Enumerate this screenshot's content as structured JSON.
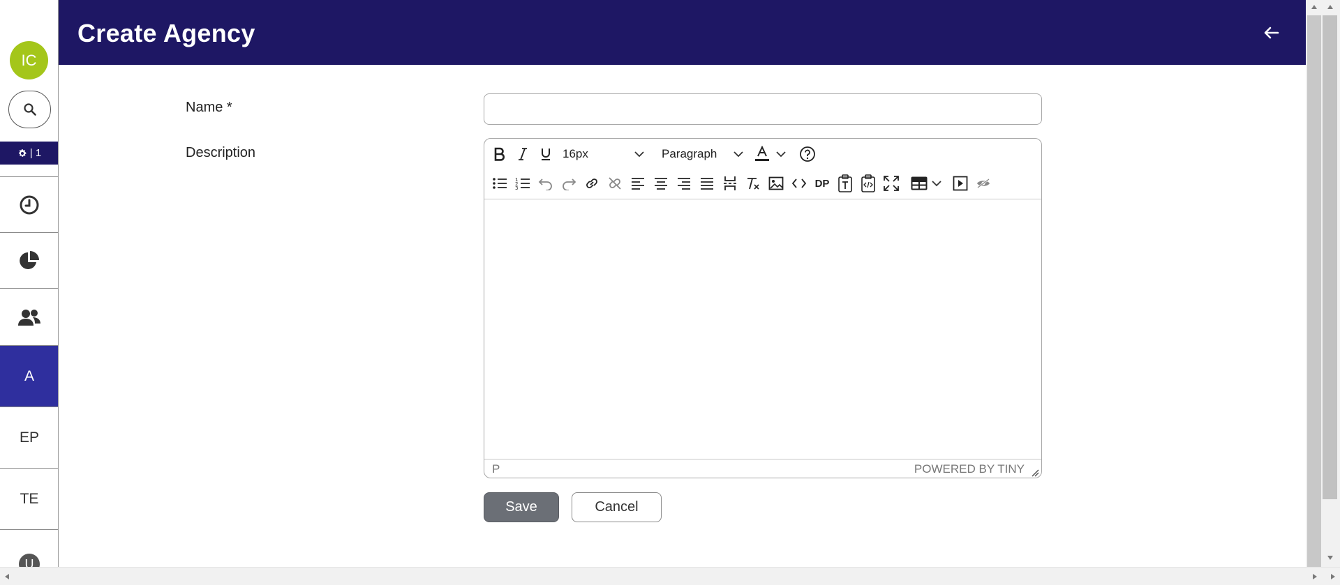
{
  "sidebar": {
    "avatar_initials": "IC",
    "settings_label": "| 1",
    "items": [
      {
        "name": "history",
        "icon": "clock-icon"
      },
      {
        "name": "reports",
        "icon": "pie-chart-icon"
      },
      {
        "name": "users",
        "icon": "users-icon"
      },
      {
        "name": "agencies",
        "label": "A",
        "active": true
      },
      {
        "name": "ep",
        "label": "EP"
      },
      {
        "name": "te",
        "label": "TE"
      },
      {
        "name": "more",
        "label": "U"
      }
    ]
  },
  "header": {
    "title": "Create Agency",
    "back_icon": "arrow-left-icon",
    "background": "#1e1764"
  },
  "form": {
    "name_label": "Name *",
    "name_value": "",
    "description_label": "Description"
  },
  "editor": {
    "font_size": "16px",
    "block_format": "Paragraph",
    "dp_label": "DP",
    "status_path": "P",
    "branding": "POWERED BY TINY"
  },
  "actions": {
    "save_label": "Save",
    "cancel_label": "Cancel"
  },
  "colors": {
    "accent": "#1e1764",
    "active_sidebar": "#2f2f9e",
    "avatar": "#a4c61a",
    "save_button": "#6b6f76"
  }
}
